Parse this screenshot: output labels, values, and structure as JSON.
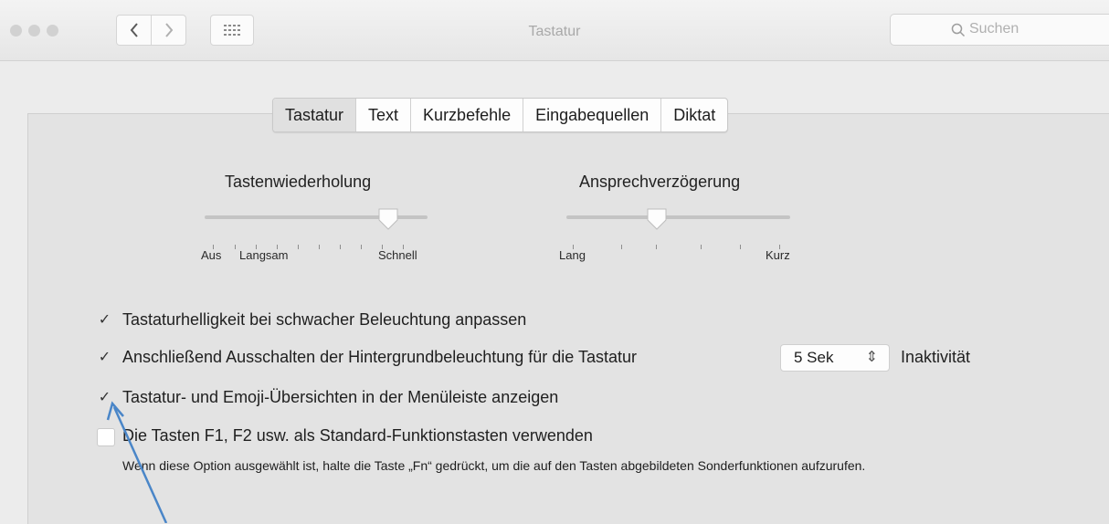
{
  "window": {
    "title": "Tastatur"
  },
  "toolbar": {
    "back_label": "<",
    "forward_label": ">",
    "grid_icon": "grid-icon",
    "search_placeholder": "Suchen"
  },
  "tabs": [
    {
      "label": "Tastatur",
      "active": true
    },
    {
      "label": "Text",
      "active": false
    },
    {
      "label": "Kurzbefehle",
      "active": false
    },
    {
      "label": "Eingabequellen",
      "active": false
    },
    {
      "label": "Diktat",
      "active": false
    }
  ],
  "sliders": {
    "repeat": {
      "title": "Tastenwiederholung",
      "label_off": "Aus",
      "label_min": "Langsam",
      "label_max": "Schnell",
      "level": 0.85
    },
    "delay": {
      "title": "Ansprechverzögerung",
      "label_min": "Lang",
      "label_max": "Kurz",
      "level": 0.4
    }
  },
  "options": [
    {
      "label": "Tastaturhelligkeit bei schwacher Beleuchtung anpassen",
      "checked": true
    },
    {
      "label": "Anschließend Ausschalten der Hintergrundbeleuchtung für die Tastatur",
      "checked": true
    },
    {
      "label": "Tastatur- und Emoji-Übersichten in der Menüleiste anzeigen",
      "checked": true
    },
    {
      "label": "Die Tasten F1, F2 usw. als Standard-Funktionstasten verwenden",
      "checked": false
    }
  ],
  "backlight": {
    "value": "5 Sek",
    "suffix": "Inaktivität"
  },
  "fn_note": "Wenn diese Option ausgewählt ist, halte die Taste „Fn“ gedrückt, um die auf den Tasten abgebildeten Sonderfunktionen aufzurufen.",
  "check_mark": "✓",
  "colors": {
    "window_bg": "#ececec",
    "panel_bg": "#e3e3e3",
    "annotation_arrow": "#4a86c8"
  }
}
